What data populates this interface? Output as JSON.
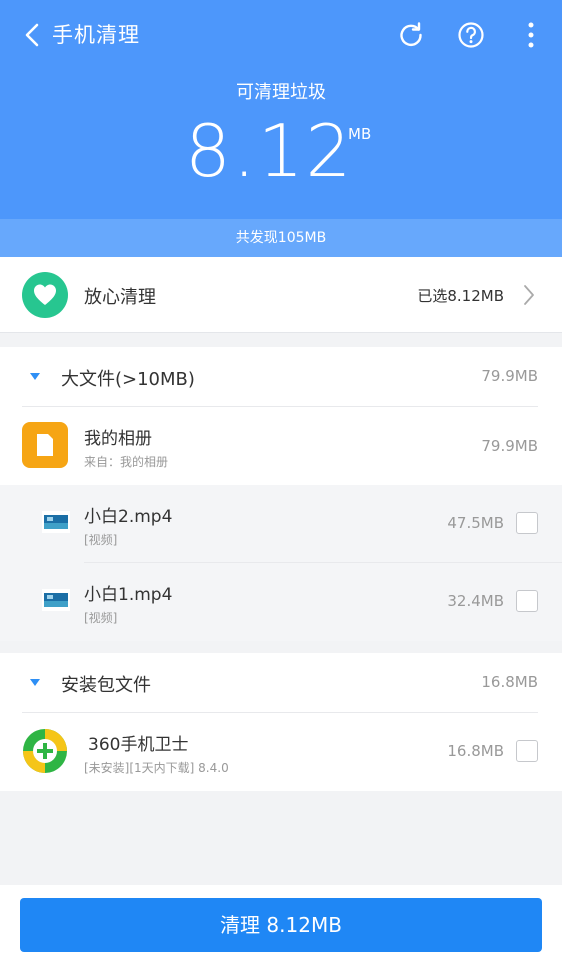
{
  "header": {
    "title": "手机清理",
    "junk_label": "可清理垃圾",
    "junk_value": "8.12",
    "junk_unit": "MB",
    "found_text": "共发现105MB",
    "bg_color": "#4d97fb"
  },
  "safe_clean": {
    "label": "放心清理",
    "selected": "已选8.12MB",
    "icon": "heart-icon"
  },
  "big_files": {
    "title": "大文件(>10MB)",
    "size": "79.9MB",
    "album": {
      "name": "我的相册",
      "source": "来自：我的相册",
      "size": "79.9MB",
      "icon": "document-icon"
    },
    "items": [
      {
        "name": "小白2.mp4",
        "type": "[视频]",
        "size": "47.5MB"
      },
      {
        "name": "小白1.mp4",
        "type": "[视频]",
        "size": "32.4MB"
      }
    ]
  },
  "apk_files": {
    "title": "安装包文件",
    "size": "16.8MB",
    "items": [
      {
        "name": "360手机卫士",
        "meta": "[未安装][1天内下载] 8.4.0",
        "size": "16.8MB",
        "icon": "360-security-icon"
      }
    ]
  },
  "footer": {
    "button_label": "清理 8.12MB",
    "button_color": "#1f87f5"
  }
}
